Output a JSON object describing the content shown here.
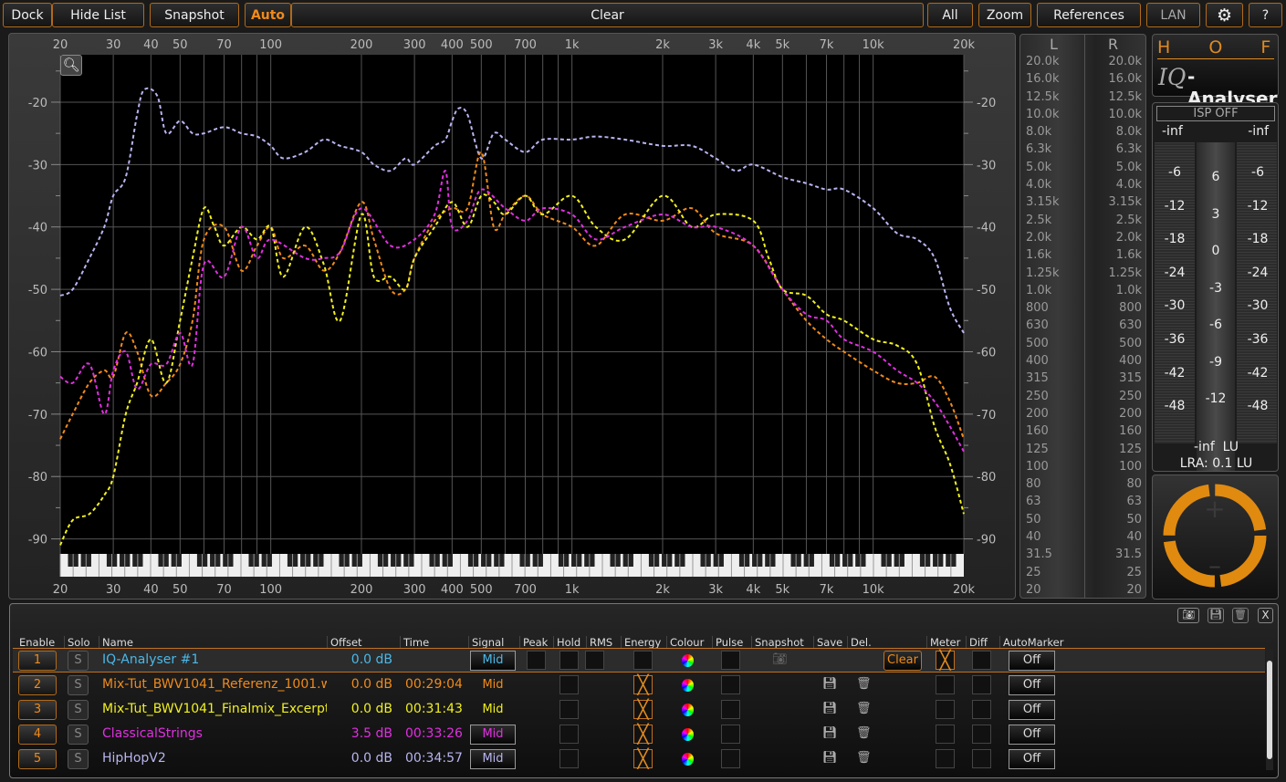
{
  "toolbar": {
    "dock": "Dock",
    "hide_list": "Hide List",
    "snapshot": "Snapshot",
    "auto": "Auto",
    "clear": "Clear",
    "all": "All",
    "zoom": "Zoom",
    "references": "References",
    "lan": "LAN",
    "help": "?",
    "accent": "#f08a1a"
  },
  "chart_data": {
    "type": "line",
    "x_scale": "log",
    "xlim": [
      20,
      20000
    ],
    "ylim": [
      -92.4,
      -12.4
    ],
    "grid": true,
    "x_ticks": [
      "20",
      "30",
      "40",
      "50",
      "70",
      "100",
      "200",
      "300",
      "400",
      "500",
      "700",
      "1k",
      "2k",
      "3k",
      "4k",
      "5k",
      "7k",
      "10k",
      "20k"
    ],
    "x_tick_values": [
      20,
      30,
      40,
      50,
      70,
      100,
      200,
      300,
      400,
      500,
      700,
      1000,
      2000,
      3000,
      4000,
      5000,
      7000,
      10000,
      20000
    ],
    "y_ticks": [
      -20,
      -30,
      -40,
      -50,
      -60,
      -70,
      -80,
      -90
    ],
    "series": [
      {
        "name": "HipHopV2",
        "color": "#b8b4f0",
        "points": [
          [
            20,
            -51
          ],
          [
            22,
            -50
          ],
          [
            25,
            -45
          ],
          [
            28,
            -40
          ],
          [
            30,
            -35
          ],
          [
            33,
            -32
          ],
          [
            36,
            -22
          ],
          [
            38,
            -18
          ],
          [
            42,
            -19
          ],
          [
            45,
            -25
          ],
          [
            50,
            -23
          ],
          [
            55,
            -25
          ],
          [
            60,
            -25
          ],
          [
            70,
            -24
          ],
          [
            80,
            -25
          ],
          [
            90,
            -25.5
          ],
          [
            100,
            -27
          ],
          [
            110,
            -29
          ],
          [
            130,
            -28
          ],
          [
            150,
            -26
          ],
          [
            170,
            -27
          ],
          [
            200,
            -28
          ],
          [
            220,
            -30
          ],
          [
            250,
            -31
          ],
          [
            280,
            -29
          ],
          [
            300,
            -30
          ],
          [
            350,
            -27
          ],
          [
            380,
            -26
          ],
          [
            400,
            -23
          ],
          [
            420,
            -21
          ],
          [
            450,
            -22
          ],
          [
            500,
            -29
          ],
          [
            550,
            -25
          ],
          [
            600,
            -26
          ],
          [
            700,
            -28
          ],
          [
            800,
            -26
          ],
          [
            1000,
            -26
          ],
          [
            1200,
            -25.5
          ],
          [
            1500,
            -26
          ],
          [
            2000,
            -27
          ],
          [
            2500,
            -27
          ],
          [
            3000,
            -29
          ],
          [
            3500,
            -31
          ],
          [
            4000,
            -30
          ],
          [
            5000,
            -32
          ],
          [
            6000,
            -33
          ],
          [
            7000,
            -34
          ],
          [
            8000,
            -34
          ],
          [
            10000,
            -37
          ],
          [
            12000,
            -41
          ],
          [
            14000,
            -42
          ],
          [
            16000,
            -45
          ],
          [
            18000,
            -53
          ],
          [
            20000,
            -57
          ]
        ]
      },
      {
        "name": "Mix-Tut_BWV1041_Referenz_1001.w",
        "color": "#f08a1a",
        "points": [
          [
            20,
            -74
          ],
          [
            22,
            -70
          ],
          [
            25,
            -65
          ],
          [
            28,
            -63
          ],
          [
            30,
            -64
          ],
          [
            33,
            -57
          ],
          [
            36,
            -60
          ],
          [
            40,
            -67
          ],
          [
            45,
            -65
          ],
          [
            50,
            -62
          ],
          [
            55,
            -55
          ],
          [
            60,
            -42
          ],
          [
            70,
            -40
          ],
          [
            80,
            -47
          ],
          [
            90,
            -43
          ],
          [
            100,
            -40
          ],
          [
            110,
            -45
          ],
          [
            130,
            -43
          ],
          [
            150,
            -47
          ],
          [
            170,
            -44
          ],
          [
            200,
            -36
          ],
          [
            220,
            -42
          ],
          [
            250,
            -50
          ],
          [
            280,
            -50
          ],
          [
            300,
            -45
          ],
          [
            350,
            -39
          ],
          [
            400,
            -37
          ],
          [
            450,
            -37
          ],
          [
            500,
            -28
          ],
          [
            550,
            -40
          ],
          [
            600,
            -38
          ],
          [
            700,
            -35
          ],
          [
            800,
            -38
          ],
          [
            1000,
            -40
          ],
          [
            1200,
            -43
          ],
          [
            1500,
            -38
          ],
          [
            2000,
            -39
          ],
          [
            2500,
            -37
          ],
          [
            3000,
            -41
          ],
          [
            4000,
            -43
          ],
          [
            5000,
            -50
          ],
          [
            6000,
            -55
          ],
          [
            7000,
            -58
          ],
          [
            8000,
            -60
          ],
          [
            10000,
            -63
          ],
          [
            12000,
            -65
          ],
          [
            14000,
            -65
          ],
          [
            16000,
            -64
          ],
          [
            18000,
            -68
          ],
          [
            20000,
            -74
          ]
        ]
      },
      {
        "name": "Mix-Tut_BWV1041_Finalmix_Excerpt",
        "color": "#f0f020",
        "points": [
          [
            20,
            -91
          ],
          [
            22,
            -87
          ],
          [
            25,
            -86
          ],
          [
            28,
            -83
          ],
          [
            30,
            -80
          ],
          [
            33,
            -70
          ],
          [
            36,
            -65
          ],
          [
            40,
            -58
          ],
          [
            45,
            -65
          ],
          [
            50,
            -55
          ],
          [
            55,
            -45
          ],
          [
            60,
            -37
          ],
          [
            65,
            -40
          ],
          [
            70,
            -43
          ],
          [
            80,
            -40
          ],
          [
            90,
            -42
          ],
          [
            100,
            -40
          ],
          [
            110,
            -48
          ],
          [
            130,
            -40
          ],
          [
            150,
            -46
          ],
          [
            170,
            -55
          ],
          [
            200,
            -38
          ],
          [
            220,
            -48
          ],
          [
            250,
            -48
          ],
          [
            280,
            -50
          ],
          [
            300,
            -45
          ],
          [
            350,
            -40
          ],
          [
            400,
            -36
          ],
          [
            450,
            -40
          ],
          [
            500,
            -35
          ],
          [
            550,
            -36
          ],
          [
            600,
            -38
          ],
          [
            700,
            -35
          ],
          [
            800,
            -38
          ],
          [
            1000,
            -35
          ],
          [
            1200,
            -40
          ],
          [
            1500,
            -42
          ],
          [
            2000,
            -35
          ],
          [
            2500,
            -40
          ],
          [
            3000,
            -38
          ],
          [
            4000,
            -39
          ],
          [
            4500,
            -45
          ],
          [
            5000,
            -50
          ],
          [
            6000,
            -51
          ],
          [
            7000,
            -54
          ],
          [
            8000,
            -55
          ],
          [
            10000,
            -58
          ],
          [
            12000,
            -59
          ],
          [
            14000,
            -62
          ],
          [
            16000,
            -72
          ],
          [
            18000,
            -78
          ],
          [
            20000,
            -86
          ]
        ]
      },
      {
        "name": "ClassicalStrings",
        "color": "#e030e0",
        "points": [
          [
            20,
            -64
          ],
          [
            22,
            -65
          ],
          [
            25,
            -62
          ],
          [
            28,
            -70
          ],
          [
            30,
            -63
          ],
          [
            33,
            -60
          ],
          [
            36,
            -66
          ],
          [
            40,
            -62
          ],
          [
            45,
            -62
          ],
          [
            50,
            -57
          ],
          [
            55,
            -62
          ],
          [
            60,
            -46
          ],
          [
            70,
            -48
          ],
          [
            80,
            -40
          ],
          [
            90,
            -45
          ],
          [
            100,
            -42
          ],
          [
            130,
            -45
          ],
          [
            150,
            -45
          ],
          [
            170,
            -44
          ],
          [
            200,
            -37
          ],
          [
            250,
            -43
          ],
          [
            300,
            -42
          ],
          [
            350,
            -38
          ],
          [
            380,
            -31
          ],
          [
            400,
            -40
          ],
          [
            450,
            -39
          ],
          [
            500,
            -34
          ],
          [
            600,
            -37
          ],
          [
            700,
            -39
          ],
          [
            800,
            -37
          ],
          [
            1000,
            -38
          ],
          [
            1200,
            -42
          ],
          [
            1500,
            -40
          ],
          [
            2000,
            -38
          ],
          [
            2500,
            -40
          ],
          [
            3000,
            -40
          ],
          [
            4000,
            -43
          ],
          [
            5000,
            -50
          ],
          [
            6000,
            -54
          ],
          [
            7000,
            -55
          ],
          [
            8000,
            -58
          ],
          [
            10000,
            -60
          ],
          [
            12000,
            -63
          ],
          [
            14000,
            -65
          ],
          [
            16000,
            -68
          ],
          [
            18000,
            -72
          ],
          [
            20000,
            -76
          ]
        ]
      }
    ]
  },
  "band_meter": {
    "left_label": "L",
    "right_label": "R",
    "bands": [
      "20.0k",
      "16.0k",
      "12.5k",
      "10.0k",
      "8.0k",
      "6.3k",
      "5.0k",
      "4.0k",
      "3.15k",
      "2.5k",
      "2.0k",
      "1.6k",
      "1.25k",
      "1.0k",
      "800",
      "630",
      "500",
      "400",
      "315",
      "250",
      "200",
      "160",
      "125",
      "100",
      "80",
      "63",
      "50",
      "40",
      "31.5",
      "25",
      "20"
    ]
  },
  "logo": {
    "brand": "H O F A",
    "product_prefix": "IQ",
    "product": "Analyser"
  },
  "level_meter": {
    "isp": "ISP OFF",
    "left_peak": "-inf",
    "right_peak": "-inf",
    "side_scale": [
      "-6",
      "-12",
      "-18",
      "-24",
      "-30",
      "-36",
      "-42",
      "-48"
    ],
    "center_scale": [
      "6",
      "3",
      "0",
      "-3",
      "-6",
      "-9",
      "-12"
    ],
    "loudness": "-inf  LU",
    "lra": "LRA: 0.1 LU"
  },
  "list": {
    "headers": [
      "Enable",
      "Solo",
      "Name",
      "Offset",
      "Time",
      "Signal",
      "Peak",
      "Hold",
      "RMS",
      "Energy",
      "Colour",
      "Pulse",
      "Snapshot",
      "Save",
      "Del.",
      "Meter",
      "Diff",
      "AutoMarker"
    ],
    "clear_label": "Clear",
    "rows": [
      {
        "num": "1",
        "solo": "S",
        "name": "IQ-Analyser #1",
        "offset": "0.0 dB",
        "time": "",
        "signal": "Mid",
        "color": "#4ab8e8",
        "automarker": "Off",
        "energy": false,
        "meter": true,
        "selected": true
      },
      {
        "num": "2",
        "solo": "S",
        "name": "Mix-Tut_BWV1041_Referenz_1001.w",
        "offset": "0.0 dB",
        "time": "00:29:04",
        "signal": "Mid",
        "color": "#f08a1a",
        "automarker": "Off",
        "energy": true,
        "meter": false
      },
      {
        "num": "3",
        "solo": "S",
        "name": "Mix-Tut_BWV1041_Finalmix_Excerpt",
        "offset": "0.0 dB",
        "time": "00:31:43",
        "signal": "Mid",
        "color": "#f0f020",
        "automarker": "Off",
        "energy": true,
        "meter": false
      },
      {
        "num": "4",
        "solo": "S",
        "name": "ClassicalStrings",
        "offset": "3.5 dB",
        "time": "00:33:26",
        "signal": "Mid",
        "color": "#e030e0",
        "automarker": "Off",
        "energy": true,
        "meter": false
      },
      {
        "num": "5",
        "solo": "S",
        "name": "HipHopV2",
        "offset": "0.0 dB",
        "time": "00:34:57",
        "signal": "Mid",
        "color": "#b8b4f0",
        "automarker": "Off",
        "energy": true,
        "meter": false
      }
    ]
  }
}
